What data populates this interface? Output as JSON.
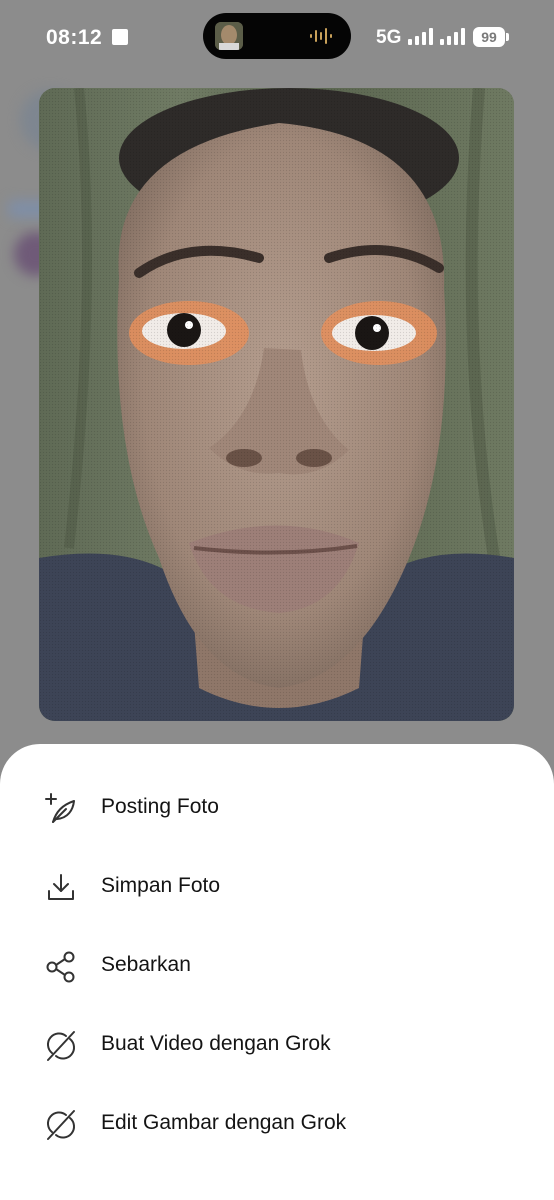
{
  "status_bar": {
    "time": "08:12",
    "network": "5G",
    "battery": "99"
  },
  "photo": {
    "description_icon": "selfie-photo"
  },
  "sheet": {
    "items": [
      {
        "label": "Posting Foto",
        "icon": "feather-plus-icon"
      },
      {
        "label": "Simpan Foto",
        "icon": "download-icon"
      },
      {
        "label": "Sebarkan",
        "icon": "share-icon"
      },
      {
        "label": "Buat Video dengan Grok",
        "icon": "grok-icon"
      },
      {
        "label": "Edit Gambar dengan Grok",
        "icon": "grok-icon"
      }
    ]
  }
}
